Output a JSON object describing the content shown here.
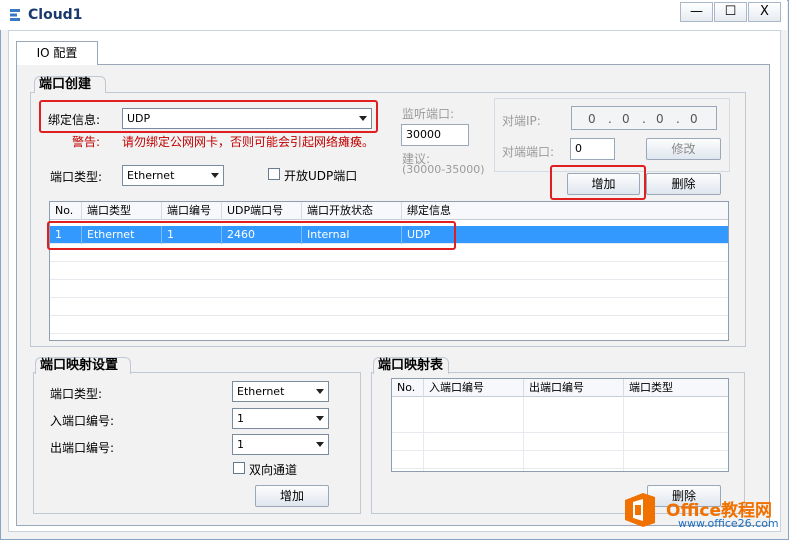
{
  "window": {
    "title": "Cloud1",
    "minimize_label": "—",
    "maximize_label": "☐",
    "close_label": "X"
  },
  "tabs": [
    {
      "label": "IO 配置"
    }
  ],
  "port_create": {
    "title": "端口创建",
    "bind_label": "绑定信息:",
    "bind_value": "UDP",
    "warning_prefix": "警告:",
    "warning_text": "请勿绑定公网网卡，否则可能会引起网络瘫痪。",
    "port_type_label": "端口类型:",
    "port_type_value": "Ethernet",
    "open_udp_label": "开放UDP端口",
    "listen_port_label": "监听端口:",
    "listen_port_value": "30000",
    "suggest_label": "建议:",
    "suggest_range": "(30000-35000)",
    "remote_ip_label": "对端IP:",
    "remote_ip_value": [
      "0",
      "0",
      "0",
      "0"
    ],
    "remote_port_label": "对端端口:",
    "remote_port_value": "0",
    "modify_label": "修改",
    "add_label": "增加",
    "delete_label": "删除",
    "table": {
      "headers": [
        "No.",
        "端口类型",
        "端口编号",
        "UDP端口号",
        "端口开放状态",
        "绑定信息"
      ],
      "rows": [
        [
          "1",
          "Ethernet",
          "1",
          "2460",
          "Internal",
          "UDP"
        ]
      ]
    }
  },
  "port_mapping_settings": {
    "title": "端口映射设置",
    "port_type_label": "端口类型:",
    "port_type_value": "Ethernet",
    "in_port_label": "入端口编号:",
    "in_port_value": "1",
    "out_port_label": "出端口编号:",
    "out_port_value": "1",
    "bidirectional_label": "双向通道",
    "add_label": "增加"
  },
  "port_mapping_table": {
    "title": "端口映射表",
    "headers": [
      "No.",
      "入端口编号",
      "出端口编号",
      "端口类型"
    ],
    "delete_label": "删除"
  },
  "watermark": {
    "brand": "Office教程网",
    "url": "www.office26.com"
  },
  "colors": {
    "highlight_red": "#e02020",
    "selection_blue": "#3399ff",
    "watermark_orange": "#f07000"
  }
}
